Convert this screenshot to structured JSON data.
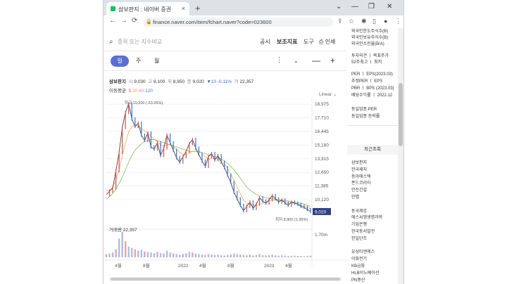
{
  "browser": {
    "tab_title": "삼보판지 : 네이버 증권",
    "tab_close": "×",
    "new_tab": "+",
    "url": "finance.naver.com/item/fchart.naver?code=023600",
    "controls": [
      "⌄",
      "—",
      "❐",
      "✕"
    ],
    "nav": [
      "←",
      "→",
      "⟳"
    ]
  },
  "chart_page": {
    "search_placeholder": "종목 또는 지수비교",
    "links": [
      "공시",
      "보조지표",
      "도구",
      "인쇄"
    ],
    "periods": [
      "일",
      "주",
      "월"
    ],
    "ohlc": {
      "name": "삼보판지",
      "open_label": "시",
      "open": "9,030",
      "high_label": "고",
      "high": "9,100",
      "low_label": "저",
      "low": "8,950",
      "close_label": "종",
      "close": "9,020",
      "change": "▼10 -0.11%",
      "volume_label": "거",
      "volume": "22,357"
    },
    "ma_label": "이동평균",
    "ma_values": [
      "5",
      "20",
      "60",
      "120"
    ],
    "scale": "Linear",
    "volume_text": "거래량 22,357",
    "high_marker": "최고 19,200 (-53.26%)",
    "low_marker": "최저 8,900 (1.35%)",
    "current_price": "9,020",
    "volume_axis": "1.70m"
  },
  "chart_data": {
    "type": "line",
    "title": "",
    "y_ticks": [
      18975,
      17710,
      16445,
      15180,
      13915,
      12650,
      11385,
      10120
    ],
    "ylim": [
      8300,
      19500
    ],
    "x_tick_labels": [
      "4월",
      "8월",
      "2022",
      "4월",
      "8월",
      "2023",
      "4월"
    ],
    "series": [
      {
        "name": "",
        "values": [
          10600,
          10900,
          11200,
          12800,
          14500,
          16800,
          18200,
          19000,
          17600,
          16900,
          17200,
          16100,
          15600,
          16300,
          15000,
          14800,
          15400,
          14200,
          14900,
          16100,
          15400,
          14700,
          14000,
          13600,
          14100,
          14600,
          15300,
          15700,
          14900,
          14300,
          13700,
          13200,
          14100,
          14400,
          13800,
          14200,
          13600,
          13100,
          12400,
          11700,
          10800,
          10200,
          9600,
          9100,
          9500,
          9900,
          9300,
          9700,
          10300,
          10000,
          9800,
          10100,
          10500,
          10200,
          9900,
          10100,
          9800,
          9600,
          9900,
          9800,
          9700,
          9500,
          9400,
          9200,
          9020
        ]
      },
      {
        "name": "",
        "values": [
          10900,
          11000,
          11300,
          11900,
          12900,
          14200,
          15400,
          16400,
          16900,
          17000,
          16900,
          16700,
          16500,
          16300,
          16000,
          15700,
          15500,
          15200,
          15100,
          15200,
          15200,
          15000,
          14800,
          14500,
          14300,
          14300,
          14400,
          14600,
          14700,
          14600,
          14400,
          14100,
          13900,
          13900,
          13900,
          13900,
          13700,
          13400,
          13000,
          12500,
          11900,
          11300,
          10700,
          10100,
          9800,
          9700,
          9600,
          9600,
          9700,
          9800,
          9900,
          10000,
          10100,
          10100,
          10100,
          10000,
          9900,
          9800,
          9800,
          9800,
          9700,
          9600,
          9500,
          9400,
          9300
        ]
      },
      {
        "name": "",
        "values": [
          10200,
          10400,
          10700,
          11100,
          11600,
          12200,
          12900,
          13600,
          14200,
          14700,
          15000,
          15300,
          15500,
          15600,
          15700,
          15700,
          15600,
          15500,
          15400,
          15300,
          15200,
          15100,
          15000,
          14900,
          14800,
          14700,
          14600,
          14600,
          14600,
          14600,
          14500,
          14400,
          14300,
          14200,
          14100,
          14000,
          13900,
          13700,
          13500,
          13200,
          12900,
          12500,
          12100,
          11700,
          11300,
          11000,
          10800,
          10600,
          10500,
          10400,
          10300,
          10300,
          10200,
          10200,
          10100,
          10100,
          10000,
          10000,
          9900,
          9900,
          9800,
          9800,
          9700,
          9600,
          9500
        ]
      }
    ],
    "volume": [
      12,
      14,
      18,
      30,
      70,
      95,
      60,
      40,
      35,
      30,
      25,
      28,
      22,
      20,
      18,
      15,
      20,
      16,
      14,
      25,
      18,
      15,
      12,
      10,
      12,
      15,
      20,
      18,
      14,
      12,
      10,
      9,
      12,
      10,
      9,
      10,
      8,
      7,
      9,
      10,
      14,
      12,
      10,
      9,
      8,
      10,
      7,
      9,
      12,
      8,
      7,
      8,
      10,
      7,
      6,
      7,
      6,
      5,
      6,
      6,
      5,
      5,
      4,
      5,
      6
    ],
    "colors": {
      "price": "#333333",
      "ma5": "#e55b5b",
      "ma20": "#e6a13b",
      "ma60": "#6fb34d",
      "ma120": "#3c7bd9",
      "current_badge": "#2f3f88"
    }
  },
  "sidebar": {
    "top_items": [
      "외국인한도주식수(B)",
      "외국인보유주식수(B)",
      "외국인소진율(B/A)"
    ],
    "invest_items": [
      "투자의견 ㅣ 목표주가",
      "52주최고 ㅣ 최저"
    ],
    "per_items": [
      "PER ㅣ EPS(2023.03)",
      "추정PER ㅣ EPS",
      "PBR ㅣ BPS (2023.03)",
      "배당수익률 ㅣ 2022.12"
    ],
    "industry_items": [
      "동일업종 PER",
      "동일업종 등락률"
    ],
    "recent_title": "최근조회",
    "recent_items": [
      "삼보판지",
      "한국제지",
      "동아에스텍",
      "폰드코리아",
      "안진건설",
      "안랩",
      "",
      "동국제강",
      "에스씨엠생명과학",
      "기업은행",
      "한국동서발전",
      "한일단조",
      "",
      "유성티엔에스",
      "이화전기",
      "KB금융",
      "HLB이노베이션",
      "PN풍산"
    ]
  }
}
